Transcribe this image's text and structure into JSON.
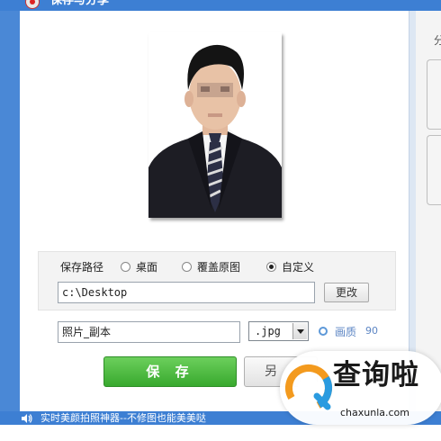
{
  "window": {
    "title": "保存与分享"
  },
  "side": {
    "label": "分"
  },
  "save_path": {
    "label": "保存路径",
    "options": [
      {
        "label": "桌面",
        "selected": false
      },
      {
        "label": "覆盖原图",
        "selected": false
      },
      {
        "label": "自定义",
        "selected": true
      }
    ],
    "value": "c:\\Desktop",
    "change_label": "更改"
  },
  "file": {
    "name": "照片_副本",
    "extension": ".jpg",
    "quality_label": "画质",
    "quality_value": "90"
  },
  "actions": {
    "save_label": "保 存",
    "save_as_label": "另"
  },
  "status": {
    "text": "实时美颜拍照神器--不修图也能美美哒"
  },
  "watermark": {
    "chinese": "查询啦",
    "url": "chaxunla.com"
  },
  "colors": {
    "title_bar": "#3d7fd3",
    "save_button": "#38a92e",
    "link_blue": "#5d86c4",
    "watermark_orange": "#f39a1e",
    "watermark_blue": "#2a9be0"
  }
}
